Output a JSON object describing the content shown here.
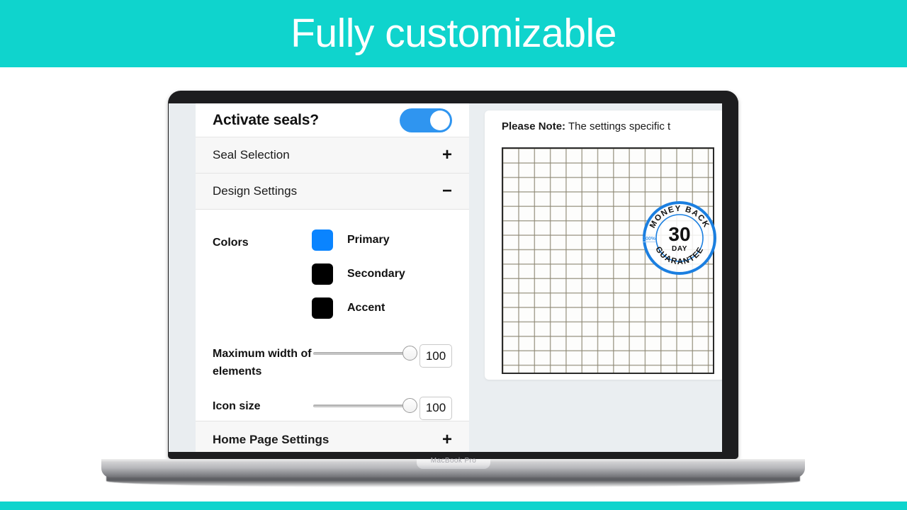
{
  "banner": {
    "title": "Fully customizable",
    "bg_color": "#0fd4cd",
    "text_color": "#ffffff"
  },
  "device": {
    "name": "MacBook Pro",
    "bezel_color": "#1d1d1f"
  },
  "app": {
    "settings_panel": {
      "activate_row": {
        "label": "Activate seals?",
        "toggle_state": "on",
        "toggle_color": "#2f95f0"
      },
      "accordions": [
        {
          "label": "Seal Selection",
          "sign": "+",
          "expanded": false
        },
        {
          "label": "Design Settings",
          "sign": "−",
          "expanded": true
        }
      ],
      "design_settings": {
        "colors_label": "Colors",
        "swatches": [
          {
            "name": "Primary",
            "color": "#0a84ff"
          },
          {
            "name": "Secondary",
            "color": "#000000"
          },
          {
            "name": "Accent",
            "color": "#000000"
          }
        ],
        "sliders": [
          {
            "label": "Maximum width of elements",
            "value": "100",
            "percent": 100
          },
          {
            "label": "Icon size",
            "value": "100",
            "percent": 100
          }
        ]
      },
      "footer_accordion": {
        "label": "Home Page Settings",
        "sign": "+",
        "expanded": false
      }
    },
    "preview": {
      "note_prefix": "Please Note:",
      "note_text": " The settings specific t",
      "seal": {
        "top_arc_text": "MONEY BACK",
        "bottom_arc_text": "GUARANTEE",
        "center_number": "30",
        "center_unit": "DAY",
        "side_badge": "100%",
        "ring_color": "#1b7fe0",
        "text_color": "#111111"
      }
    }
  }
}
